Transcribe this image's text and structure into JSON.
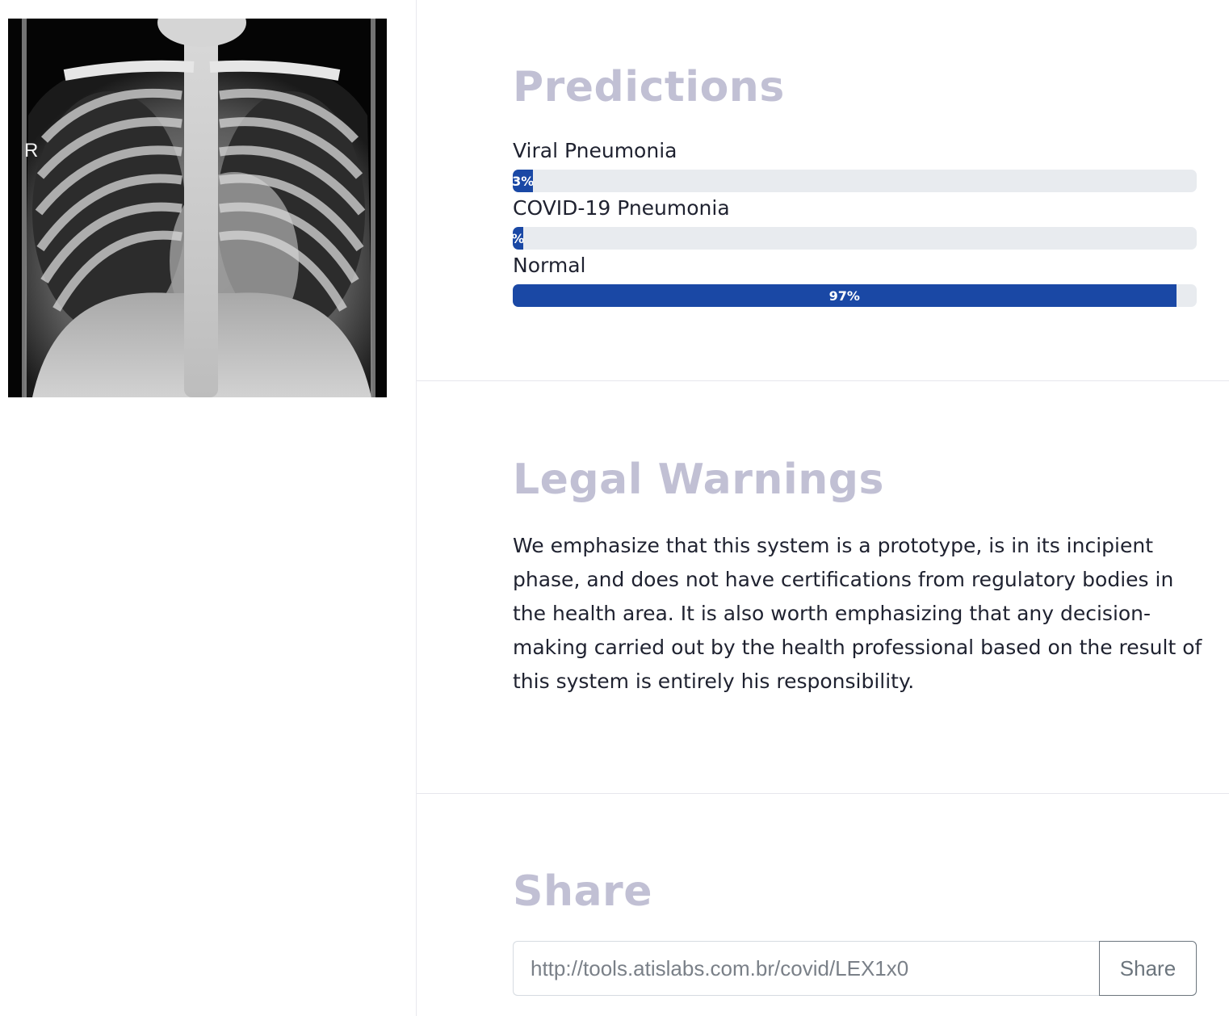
{
  "xray_image": {
    "marker": "R"
  },
  "predictions": {
    "title": "Predictions",
    "items": [
      {
        "label": "Viral Pneumonia",
        "value": 3,
        "bar_text": "3%"
      },
      {
        "label": "COVID-19 Pneumonia",
        "value": 1.5,
        "bar_text": "%"
      },
      {
        "label": "Normal",
        "value": 97,
        "bar_text": "97%"
      }
    ],
    "bar_color": "#1a48a5",
    "track_color": "#e8ebef"
  },
  "legal": {
    "title": "Legal Warnings",
    "text": "We emphasize that this system is a prototype, is in its incipient phase, and does not have certifications from regulatory bodies in the health area. It is also worth emphasizing that any decision-making carried out by the health professional based on the result of this system is entirely his responsibility."
  },
  "share": {
    "title": "Share",
    "url": "http://tools.atislabs.com.br/covid/LEX1x0",
    "button_label": "Share"
  },
  "colors": {
    "heading": "#c1c0d4",
    "text": "#1f2230"
  }
}
